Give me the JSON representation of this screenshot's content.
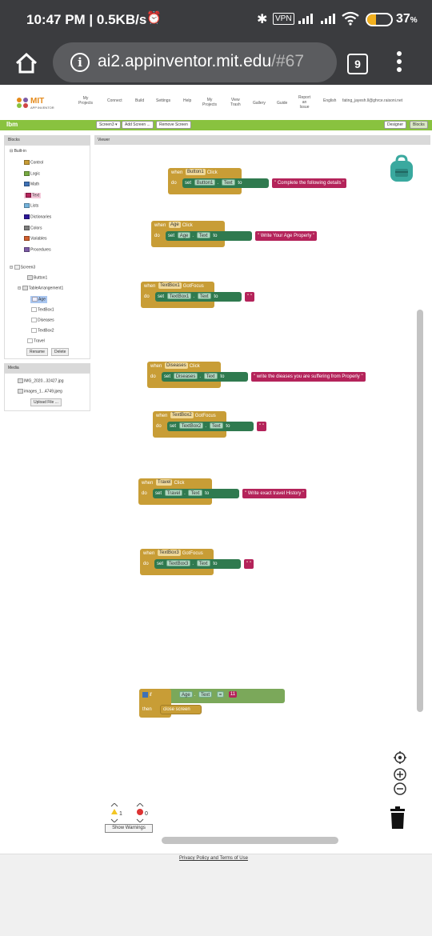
{
  "status": {
    "clock": "10:47 PM | 0.5KB/s",
    "vpn": "VPN",
    "battery": "37",
    "battery_unit": "%",
    "battery_level": 0.37
  },
  "browser": {
    "url_host": "ai2.appinventor.mit.edu",
    "url_path": "/#67",
    "tab_count": "9"
  },
  "app": {
    "logo_mit": "MIT",
    "logo_sub": "APP INVENTOR",
    "nav": [
      "My\nProjects",
      "Connect",
      "Build",
      "Settings",
      "Help",
      "My\nProjects",
      "View\nTrash",
      "Gallery",
      "Guide",
      "Report\nan\nIssue",
      "English",
      "fating_jayesh.ll@ghrce.raisoni.net"
    ],
    "project_name": "Ibm",
    "screen_btn": "Screen3 ▾",
    "add_screen": "Add Screen ...",
    "remove_screen": "Remove Screen",
    "designer": "Designer",
    "blocks": "Blocks",
    "blocks_head": "Blocks",
    "viewer_head": "Viewer",
    "builtin": "Built-in",
    "builtin_items": [
      {
        "label": "Control",
        "color": "#c89d36"
      },
      {
        "label": "Logic",
        "color": "#77ab41"
      },
      {
        "label": "Math",
        "color": "#3f71b5"
      },
      {
        "label": "Text",
        "color": "#b4235a"
      },
      {
        "label": "Lists",
        "color": "#74b3dc"
      },
      {
        "label": "Dictionaries",
        "color": "#2d1799"
      },
      {
        "label": "Colors",
        "color": "#7d7d7d"
      },
      {
        "label": "Variables",
        "color": "#d05f2d"
      },
      {
        "label": "Procedures",
        "color": "#7c5ba6"
      }
    ],
    "screen_node": "Screen3",
    "components": [
      "Button1",
      "TableArrangement1",
      "Age",
      "TextBox1",
      "Diseases",
      "TextBox2",
      "Travel"
    ],
    "rename": "Rename",
    "delete": "Delete",
    "media_head": "Media",
    "media_files": [
      "IMG_2020...32427.jpg",
      "images_1...4749.jpeg"
    ],
    "upload": "Upload File ...",
    "blocks_list": [
      {
        "event": "Click",
        "comp": "Button1",
        "prop": "Text",
        "text": "Complete the following details"
      },
      {
        "event": "Click",
        "comp": "Age",
        "prop": "Text",
        "text": "Write Your Age Properly"
      },
      {
        "event": "GotFocus",
        "comp": "TextBox1",
        "prop": "Text",
        "text": ""
      },
      {
        "event": "Click",
        "comp": "Diseases",
        "prop": "Text",
        "text": "write the dieases you are suffering from Properly"
      },
      {
        "event": "GotFocus",
        "comp": "TextBox2",
        "prop": "Text",
        "text": ""
      },
      {
        "event": "Click",
        "comp": "Travel",
        "prop": "Text",
        "text": "Write exact travel History"
      },
      {
        "event": "GotFocus",
        "comp": "TextBox3",
        "prop": "Text",
        "text": ""
      }
    ],
    "kw_when": "when",
    "kw_do": "do",
    "kw_set": "set",
    "kw_to": "to",
    "kw_if": "if",
    "kw_then": "then",
    "if_comp": "Age",
    "if_prop": "Text",
    "if_op": "=",
    "if_value": "11",
    "then_action": "close screen",
    "warnings": "1",
    "errors": "0",
    "show_warnings": "Show Warnings",
    "privacy": "Privacy Policy and Terms of Use"
  }
}
